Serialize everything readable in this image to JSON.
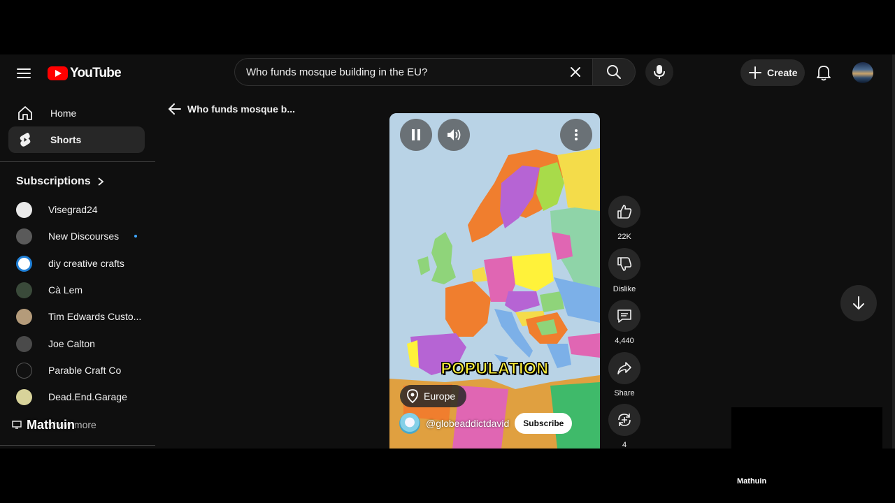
{
  "header": {
    "logo_text": "YouTube",
    "search_query": "Who funds mosque building in the EU?",
    "create_label": "Create"
  },
  "sidebar": {
    "items": [
      {
        "label": "Home",
        "icon": "home-icon"
      },
      {
        "label": "Shorts",
        "icon": "shorts-icon",
        "active": true
      }
    ],
    "subscriptions_title": "Subscriptions",
    "subscriptions": [
      {
        "name": "Visegrad24",
        "color": "#e9e9e9"
      },
      {
        "name": "New Discourses",
        "color": "#5a5a5a",
        "new": true
      },
      {
        "name": "diy creative crafts",
        "color": "#1f7fd6"
      },
      {
        "name": "Cà Lem",
        "color": "#3a4a3a"
      },
      {
        "name": "Tim Edwards Custo...",
        "color": "#b49b7a"
      },
      {
        "name": "Joe Calton",
        "color": "#4a4a4a"
      },
      {
        "name": "Parable Craft Co",
        "color": "#111111"
      },
      {
        "name": "Dead.End.Garage",
        "color": "#d8d39a"
      }
    ],
    "show_more": "Show more",
    "overlay_name": "Mathuin"
  },
  "back_link": {
    "label": "Who funds mosque b..."
  },
  "player": {
    "caption": "POPULATION",
    "location": "Europe",
    "channel": "@globeaddictdavid",
    "subscribe_label": "Subscribe"
  },
  "actions": {
    "like_count": "22K",
    "dislike_label": "Dislike",
    "comment_count": "4,440",
    "share_label": "Share",
    "remix_count": "4"
  },
  "footer": {
    "mini_name": "Mathuin"
  },
  "colors": {
    "accent": "#ff0000",
    "badge": "#3ea6ff"
  }
}
